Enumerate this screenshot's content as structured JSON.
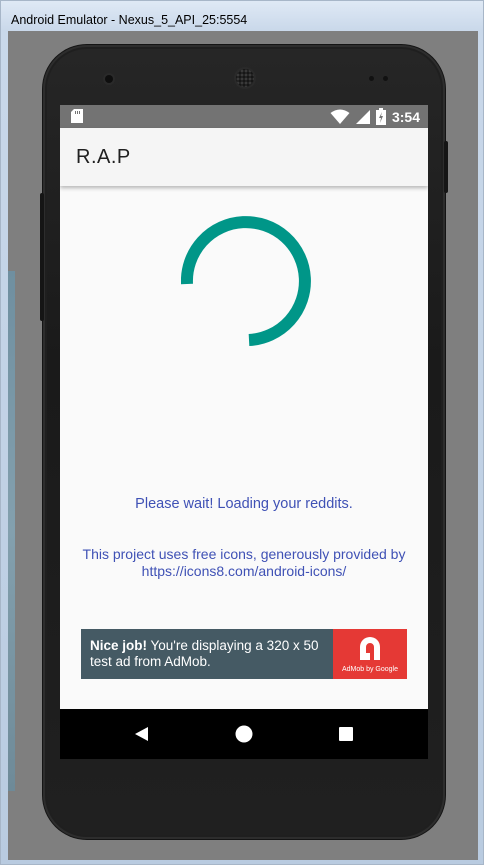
{
  "window": {
    "title": "Android Emulator - Nexus_5_API_25:5554"
  },
  "status_bar": {
    "time": "3:54",
    "icons": [
      "sd-card-icon",
      "wifi-icon",
      "battery-icon"
    ]
  },
  "app_bar": {
    "title": "R.A.P"
  },
  "content": {
    "spinner_color": "#009688",
    "loading_message": "Please wait! Loading your reddits.",
    "credits_line1": "This project uses free icons, generously provided by",
    "credits_line2": "https://icons8.com/android-icons/"
  },
  "ad_banner": {
    "headline": "Nice job!",
    "body": " You're displaying a 320 x 50 test ad from AdMob.",
    "logo_caption": "AdMob by Google",
    "background_color": "#455a64",
    "logo_color": "#e53935"
  },
  "nav_bar": {
    "buttons": [
      "back-icon",
      "home-icon",
      "recents-icon"
    ]
  },
  "colors": {
    "accent_text": "#3f51b5",
    "status_bar": "#737373",
    "app_bar": "#f5f5f5"
  }
}
